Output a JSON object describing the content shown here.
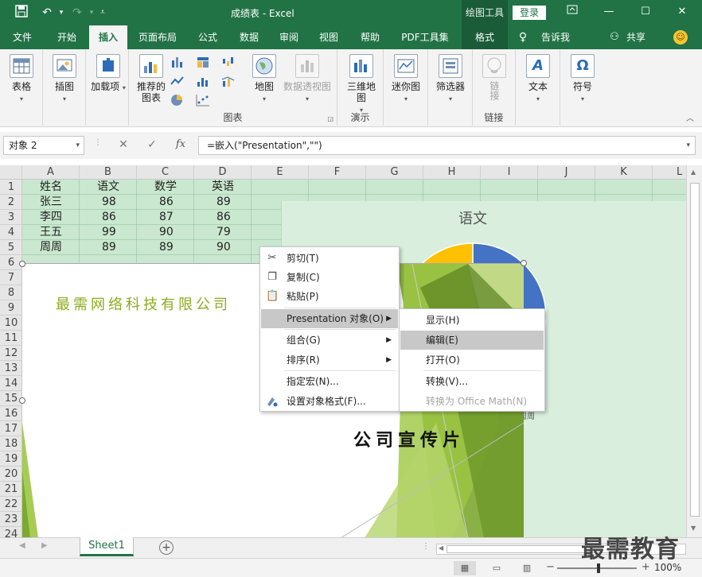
{
  "titlebar": {
    "title": "成绩表 - Excel",
    "context_tool": "绘图工具",
    "login": "登录",
    "qa_save_icon": "save-icon",
    "qa_undo_icon": "undo-icon",
    "qa_redo_icon": "redo-icon",
    "qa_customize": "customize-icon"
  },
  "tabs": [
    "文件",
    "开始",
    "插入",
    "页面布局",
    "公式",
    "数据",
    "审阅",
    "视图",
    "帮助",
    "PDF工具集",
    "格式"
  ],
  "active_tab": "插入",
  "tell_me": "告诉我",
  "share": "共享",
  "ribbon": {
    "table": "表格",
    "illustrations": "插图",
    "addins": "加载项",
    "recommended_charts": "推荐的图表",
    "map": "地图",
    "pivot_chart": "数据透视图",
    "map3d": "三维地图",
    "sparkline": "迷你图",
    "slicer": "筛选器",
    "link": "链接",
    "text": "文本",
    "symbol": "符号",
    "group_charts": "图表",
    "group_tours": "演示",
    "group_links": "链接"
  },
  "formula_bar": {
    "name_box": "对象 2",
    "formula": "=嵌入(\"Presentation\",\"\")",
    "fx": "fx"
  },
  "columns": [
    "A",
    "B",
    "C",
    "D",
    "E",
    "F",
    "G",
    "H",
    "I",
    "J",
    "K",
    "L"
  ],
  "rows": [
    "1",
    "2",
    "3",
    "4",
    "5",
    "6",
    "7",
    "8",
    "9",
    "10",
    "11",
    "12",
    "13",
    "14",
    "15",
    "16",
    "17",
    "18",
    "19",
    "20",
    "21",
    "22",
    "23",
    "24"
  ],
  "table": {
    "headers": [
      "姓名",
      "语文",
      "数学",
      "英语"
    ],
    "data": [
      [
        "张三",
        "98",
        "86",
        "89"
      ],
      [
        "李四",
        "86",
        "87",
        "86"
      ],
      [
        "王五",
        "99",
        "90",
        "79"
      ],
      [
        "周周",
        "89",
        "89",
        "90"
      ]
    ]
  },
  "chart_data": {
    "type": "pie",
    "title": "语文",
    "categories": [
      "张三",
      "李四",
      "王五",
      "周周"
    ],
    "values": [
      98,
      86,
      99,
      89
    ],
    "colors": [
      "#4472c4",
      "#ed7d31",
      "#a5a5a5",
      "#ffc000"
    ],
    "legend_fragment": "周周"
  },
  "embedded_object": {
    "company": "最需网络科技有限公司",
    "title": "公司宣传片"
  },
  "context_menu": [
    {
      "label": "剪切(T)",
      "icon": "scissors-icon"
    },
    {
      "label": "复制(C)",
      "icon": "copy-icon"
    },
    {
      "label": "粘贴(P)",
      "icon": "paste-icon"
    },
    {
      "label": "Presentation 对象(O)",
      "submenu": true
    },
    {
      "label": "组合(G)",
      "submenu": true
    },
    {
      "label": "排序(R)",
      "submenu": true
    },
    {
      "label": "指定宏(N)..."
    },
    {
      "label": "设置对象格式(F)...",
      "icon": "format-object-icon"
    }
  ],
  "submenu": [
    {
      "label": "显示(H)"
    },
    {
      "label": "编辑(E)",
      "highlighted": true
    },
    {
      "label": "打开(O)"
    },
    {
      "label": "转换(V)..."
    },
    {
      "label": "转换为 Office Math(N)",
      "disabled": true
    }
  ],
  "sheet_tabs": [
    "Sheet1"
  ],
  "status": {
    "zoom": "100%"
  },
  "watermark": "最需教育",
  "colors": {
    "brand": "#217346",
    "cell_fill": "#c9e8cf",
    "menu_highlight": "#c8c8c8",
    "company_text": "#8cab1d"
  }
}
